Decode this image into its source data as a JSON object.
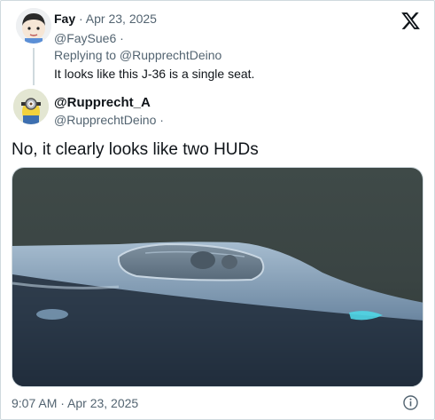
{
  "parent_tweet": {
    "name": "Fay",
    "separator": " · ",
    "date": "Apr 23, 2025",
    "handle": "@FaySue6 ·",
    "replying_to": "Replying to @RupprechtDeino",
    "text": "It looks like this J-36 is a single seat."
  },
  "main_tweet": {
    "display_name": "@Rupprecht_A",
    "handle": "@RupprechtDeino ·",
    "text": "No, it clearly looks like two HUDs",
    "timestamp": "9:07 AM · Apr 23, 2025"
  },
  "icons": {
    "brand": "x-logo-icon",
    "info": "info-icon"
  },
  "colors": {
    "text": "#0f1419",
    "secondary": "#536471",
    "border": "#cfd9de"
  }
}
